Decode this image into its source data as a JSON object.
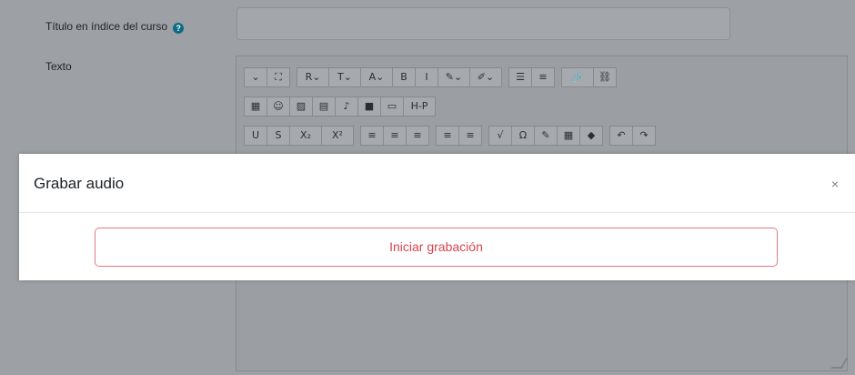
{
  "form": {
    "title_label": "Título en índice del curso",
    "help_icon": "?",
    "text_label": "Texto"
  },
  "editor": {
    "toolbar": {
      "row1": [
        [
          "⌄",
          "⛶"
        ],
        [
          "R⌄",
          "T⌄",
          "A⌄",
          "B",
          "I",
          "✎⌄",
          "✐⌄"
        ],
        [
          "☰",
          "≡"
        ],
        [
          "🔗",
          "⛓"
        ]
      ],
      "row2": [
        [
          "▦",
          "☺",
          "▨",
          "▤",
          "♪",
          "■",
          "▭",
          "H-P"
        ]
      ],
      "row3": [
        [
          "U",
          "S",
          "X₂",
          "X²"
        ],
        [
          "≡",
          "≡",
          "≡"
        ],
        [
          "≡",
          "≡"
        ],
        [
          "√",
          "Ω",
          "✎",
          "▦",
          "◆"
        ],
        [
          "↶",
          "↷"
        ]
      ]
    }
  },
  "modal": {
    "title": "Grabar audio",
    "close": "×",
    "record_label": "Iniciar grabación"
  },
  "colors": {
    "accent_danger": "#d6454f",
    "help_icon": "#0f6c86"
  }
}
